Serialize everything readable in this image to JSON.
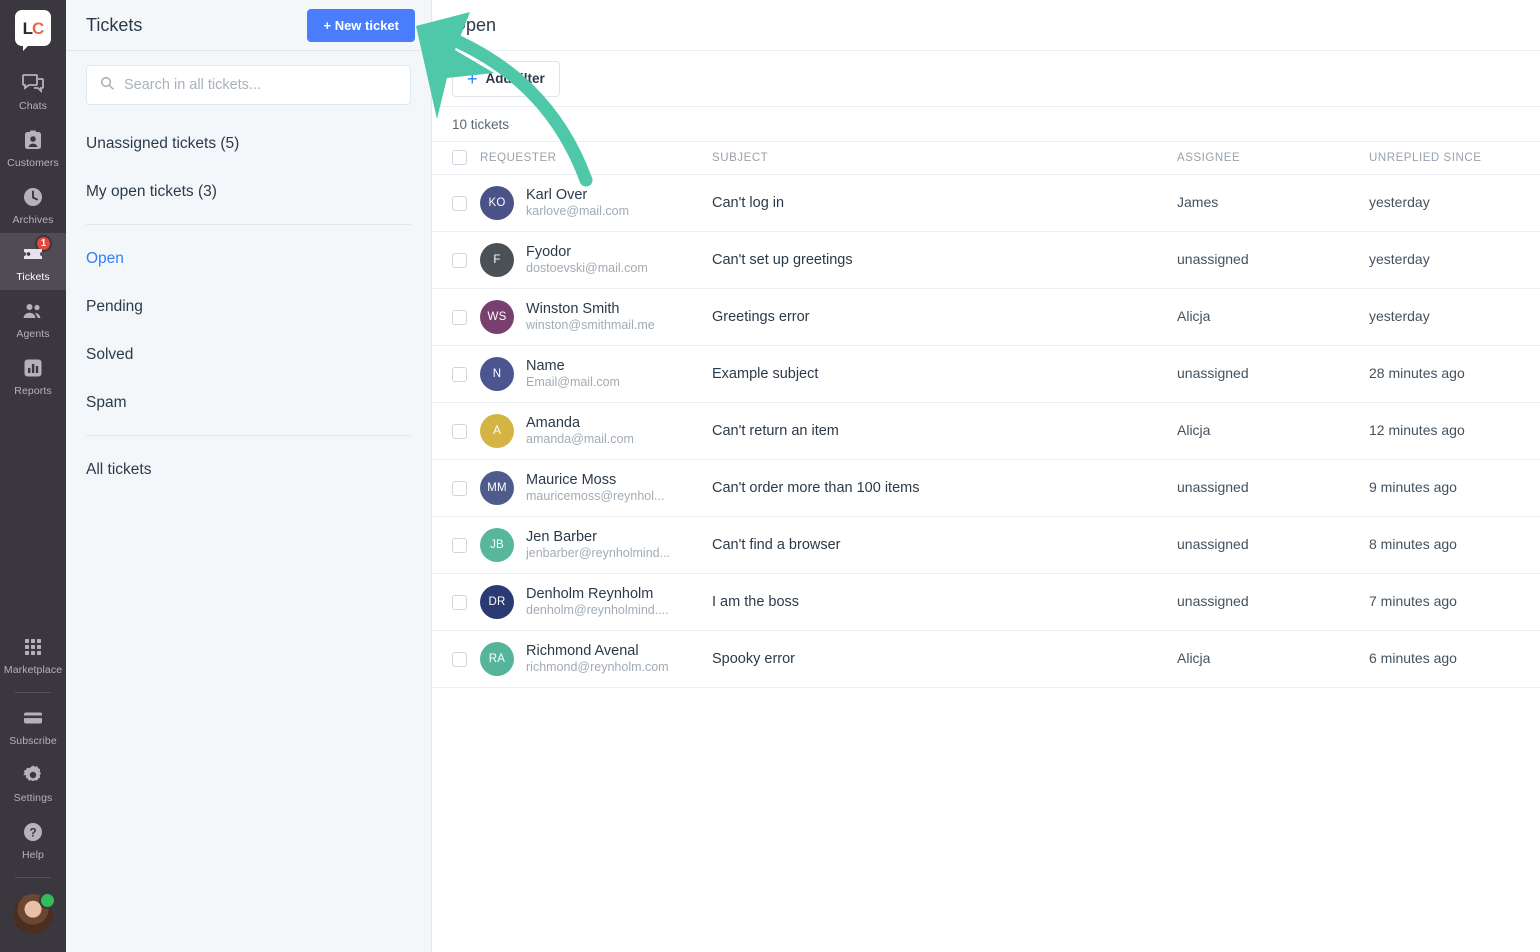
{
  "colors": {
    "accent_blue": "#4a7dfc",
    "link_blue": "#2d7ff9",
    "rail_bg": "#3b373f",
    "panel_bg": "#f4f7f9",
    "badge_red": "#e4483c",
    "arrow_green": "#4ec8a8",
    "status_green": "#32bd57"
  },
  "rail": {
    "logo_left": "L",
    "logo_right": "C",
    "items": [
      {
        "label": "Chats",
        "icon": "chats-icon",
        "active": false,
        "badge": ""
      },
      {
        "label": "Customers",
        "icon": "customers-icon",
        "active": false,
        "badge": ""
      },
      {
        "label": "Archives",
        "icon": "archives-icon",
        "active": false,
        "badge": ""
      },
      {
        "label": "Tickets",
        "icon": "tickets-icon",
        "active": true,
        "badge": "1"
      },
      {
        "label": "Agents",
        "icon": "agents-icon",
        "active": false,
        "badge": ""
      },
      {
        "label": "Reports",
        "icon": "reports-icon",
        "active": false,
        "badge": ""
      }
    ],
    "bottom_items": [
      {
        "label": "Marketplace",
        "icon": "marketplace-icon"
      },
      {
        "label": "Subscribe",
        "icon": "subscribe-icon"
      },
      {
        "label": "Settings",
        "icon": "gear-icon"
      },
      {
        "label": "Help",
        "icon": "help-icon"
      }
    ]
  },
  "panel": {
    "title": "Tickets",
    "new_ticket_label": "+ New ticket",
    "search_placeholder": "Search in all tickets...",
    "search_value": "",
    "quick_links": [
      {
        "label": "Unassigned tickets (5)"
      },
      {
        "label": "My open tickets (3)"
      }
    ],
    "views": [
      {
        "label": "Open",
        "current": true
      },
      {
        "label": "Pending",
        "current": false
      },
      {
        "label": "Solved",
        "current": false
      },
      {
        "label": "Spam",
        "current": false
      }
    ],
    "all_tickets_label": "All tickets"
  },
  "main": {
    "title": "Open",
    "add_filter_label": "Add filter",
    "add_filter_plus": "+",
    "count_label": "10 tickets",
    "columns": {
      "requester": "REQUESTER",
      "subject": "SUBJECT",
      "assignee": "ASSIGNEE",
      "unreplied": "UNREPLIED SINCE"
    },
    "rows": [
      {
        "initials": "KO",
        "color": "#4a5288",
        "name": "Karl Over",
        "email": "karlove@mail.com",
        "subject": "Can't log in",
        "assignee": "James",
        "unreplied": "yesterday"
      },
      {
        "initials": "F",
        "color": "#4a5157",
        "name": "Fyodor",
        "email": "dostoevski@mail.com",
        "subject": "Can't set up greetings",
        "assignee": "unassigned",
        "unreplied": "yesterday"
      },
      {
        "initials": "WS",
        "color": "#78406e",
        "name": "Winston Smith",
        "email": "winston@smithmail.me",
        "subject": "Greetings error",
        "assignee": "Alicja",
        "unreplied": "yesterday"
      },
      {
        "initials": "N",
        "color": "#4c558f",
        "name": "Name",
        "email": "Email@mail.com",
        "subject": "Example subject",
        "assignee": "unassigned",
        "unreplied": "28 minutes ago"
      },
      {
        "initials": "A",
        "color": "#d4b544",
        "name": "Amanda",
        "email": "amanda@mail.com",
        "subject": "Can't return an item",
        "assignee": "Alicja",
        "unreplied": "12 minutes ago"
      },
      {
        "initials": "MM",
        "color": "#4e5b8c",
        "name": "Maurice Moss",
        "email": "mauricemoss@reynhol...",
        "subject": "Can't order more than 100 items",
        "assignee": "unassigned",
        "unreplied": "9 minutes ago"
      },
      {
        "initials": "JB",
        "color": "#58b79a",
        "name": "Jen Barber",
        "email": "jenbarber@reynholmind...",
        "subject": "Can't find a browser",
        "assignee": "unassigned",
        "unreplied": "8 minutes ago"
      },
      {
        "initials": "DR",
        "color": "#2b3a72",
        "name": "Denholm Reynholm",
        "email": "denholm@reynholmind....",
        "subject": "I am the boss",
        "assignee": "unassigned",
        "unreplied": "7 minutes ago"
      },
      {
        "initials": "RA",
        "color": "#56b49a",
        "name": "Richmond Avenal",
        "email": "richmond@reynholm.com",
        "subject": "Spooky error",
        "assignee": "Alicja",
        "unreplied": "6 minutes ago"
      }
    ]
  },
  "annotation": {
    "name": "green-arrow-pointing-to-new-ticket-button",
    "points_to": "+ New ticket"
  }
}
